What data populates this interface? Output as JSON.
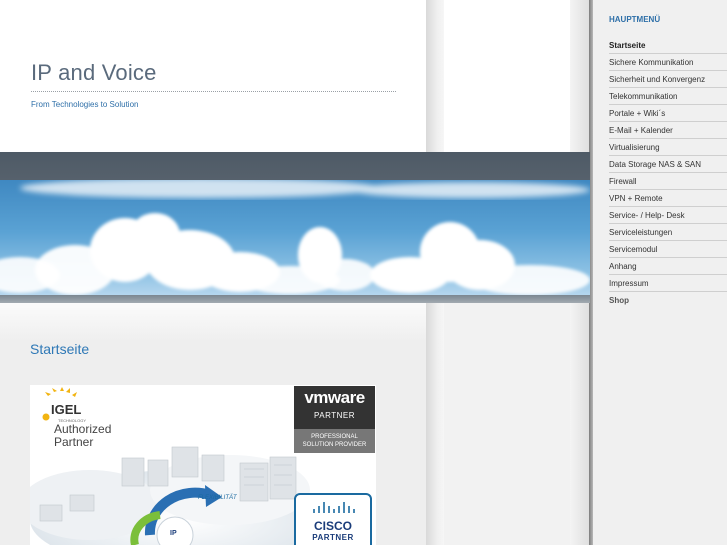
{
  "site": {
    "title": "IP and Voice",
    "tagline": "From Technologies to Solution"
  },
  "page": {
    "heading": "Startseite"
  },
  "partner_image": {
    "igel_logo_text": "IGEL",
    "igel_sub": "TECHNOLOGY",
    "authorized": "Authorized",
    "partner": "Partner",
    "vmware_word": "vmware",
    "vmware_partner": "PARTNER",
    "vmware_level_1": "PROFESSIONAL",
    "vmware_level_2": "SOLUTION PROVIDER",
    "cisco_word": "CISCO",
    "cisco_partner": "PARTNER",
    "flex_label": "FLEXIBILITÄT"
  },
  "sidebar": {
    "title": "HAUPTMENÜ",
    "items": [
      {
        "label": "Startseite"
      },
      {
        "label": "Sichere Kommunikation"
      },
      {
        "label": "Sicherheit und Konvergenz"
      },
      {
        "label": "Telekommunikation"
      },
      {
        "label": "Portale + Wiki´s"
      },
      {
        "label": "E-Mail + Kalender"
      },
      {
        "label": "Virtualisierung"
      },
      {
        "label": "Data Storage NAS & SAN"
      },
      {
        "label": "Firewall"
      },
      {
        "label": "VPN + Remote"
      },
      {
        "label": "Service- / Help- Desk"
      },
      {
        "label": "Serviceleistungen"
      },
      {
        "label": "Servicemodul"
      },
      {
        "label": "Anhang"
      },
      {
        "label": "Impressum"
      },
      {
        "label": "Shop"
      }
    ]
  },
  "colors": {
    "accent": "#2e6fa8",
    "banner_sky": "#5aa2d4",
    "dark_band": "#4e5a66"
  }
}
